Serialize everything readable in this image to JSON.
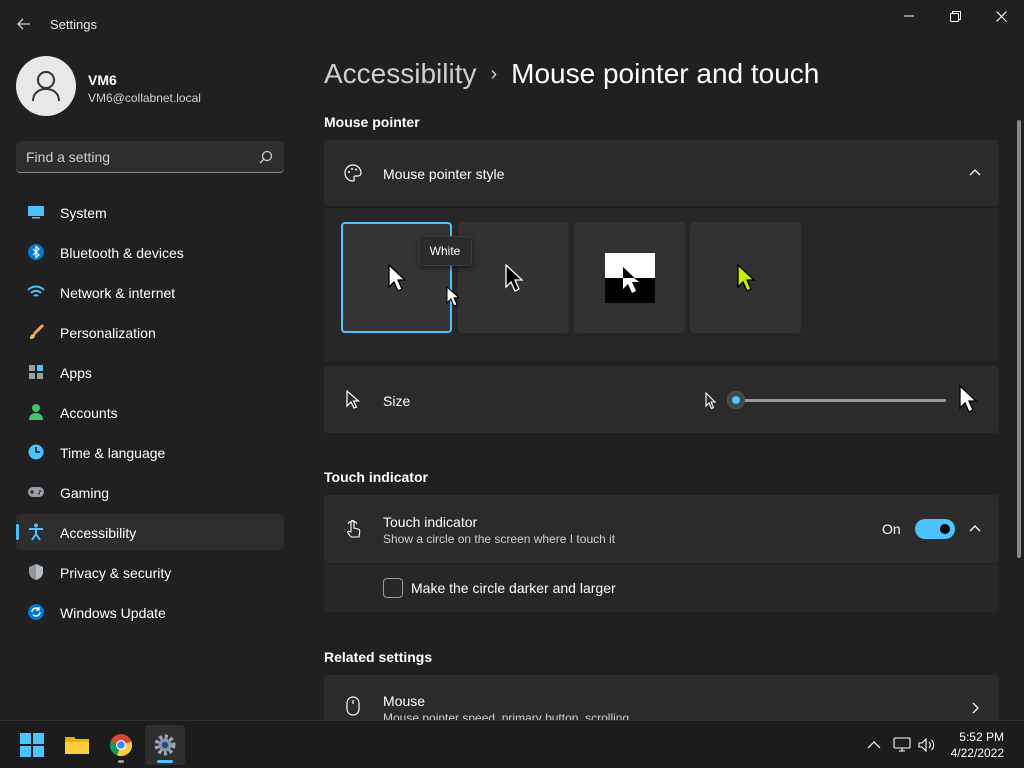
{
  "window": {
    "title": "Settings"
  },
  "profile": {
    "name": "VM6",
    "email": "VM6@collabnet.local"
  },
  "search": {
    "placeholder": "Find a setting"
  },
  "sidebar": {
    "items": [
      {
        "label": "System",
        "icon": "system-icon"
      },
      {
        "label": "Bluetooth & devices",
        "icon": "bluetooth-icon"
      },
      {
        "label": "Network & internet",
        "icon": "network-icon"
      },
      {
        "label": "Personalization",
        "icon": "brush-icon"
      },
      {
        "label": "Apps",
        "icon": "apps-icon"
      },
      {
        "label": "Accounts",
        "icon": "accounts-icon"
      },
      {
        "label": "Time & language",
        "icon": "clock-icon"
      },
      {
        "label": "Gaming",
        "icon": "gamepad-icon"
      },
      {
        "label": "Accessibility",
        "icon": "accessibility-icon",
        "active": true
      },
      {
        "label": "Privacy & security",
        "icon": "shield-icon"
      },
      {
        "label": "Windows Update",
        "icon": "update-icon"
      }
    ]
  },
  "breadcrumb": {
    "parent": "Accessibility",
    "separator": "›",
    "current": "Mouse pointer and touch"
  },
  "mouse_pointer": {
    "section_title": "Mouse pointer",
    "style_title": "Mouse pointer style",
    "options": [
      "White",
      "Black",
      "Inverted",
      "Custom"
    ],
    "selected": "White",
    "tooltip": "White",
    "size_label": "Size",
    "size_level": 0.0
  },
  "touch": {
    "section_title": "Touch indicator",
    "title": "Touch indicator",
    "subtitle": "Show a circle on the screen where I touch it",
    "toggle_label": "On",
    "toggle_on": true,
    "checkbox_label": "Make the circle darker and larger",
    "checkbox_checked": false
  },
  "related": {
    "section_title": "Related settings",
    "mouse_title": "Mouse",
    "mouse_subtitle": "Mouse pointer speed, primary button, scrolling"
  },
  "taskbar": {
    "time": "5:52 PM",
    "date": "4/22/2022"
  },
  "colors": {
    "accent": "#4cc2ff",
    "background": "#202020",
    "card": "#2b2b2b",
    "custom_pointer": "#c4f000"
  }
}
